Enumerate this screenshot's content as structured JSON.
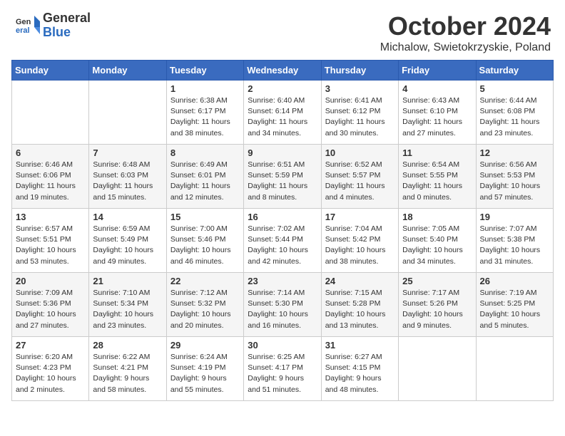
{
  "header": {
    "logo_general": "General",
    "logo_blue": "Blue",
    "month": "October 2024",
    "location": "Michalow, Swietokrzyskie, Poland"
  },
  "days_of_week": [
    "Sunday",
    "Monday",
    "Tuesday",
    "Wednesday",
    "Thursday",
    "Friday",
    "Saturday"
  ],
  "weeks": [
    [
      {
        "day": "",
        "info": ""
      },
      {
        "day": "",
        "info": ""
      },
      {
        "day": "1",
        "info": "Sunrise: 6:38 AM\nSunset: 6:17 PM\nDaylight: 11 hours and 38 minutes."
      },
      {
        "day": "2",
        "info": "Sunrise: 6:40 AM\nSunset: 6:14 PM\nDaylight: 11 hours and 34 minutes."
      },
      {
        "day": "3",
        "info": "Sunrise: 6:41 AM\nSunset: 6:12 PM\nDaylight: 11 hours and 30 minutes."
      },
      {
        "day": "4",
        "info": "Sunrise: 6:43 AM\nSunset: 6:10 PM\nDaylight: 11 hours and 27 minutes."
      },
      {
        "day": "5",
        "info": "Sunrise: 6:44 AM\nSunset: 6:08 PM\nDaylight: 11 hours and 23 minutes."
      }
    ],
    [
      {
        "day": "6",
        "info": "Sunrise: 6:46 AM\nSunset: 6:06 PM\nDaylight: 11 hours and 19 minutes."
      },
      {
        "day": "7",
        "info": "Sunrise: 6:48 AM\nSunset: 6:03 PM\nDaylight: 11 hours and 15 minutes."
      },
      {
        "day": "8",
        "info": "Sunrise: 6:49 AM\nSunset: 6:01 PM\nDaylight: 11 hours and 12 minutes."
      },
      {
        "day": "9",
        "info": "Sunrise: 6:51 AM\nSunset: 5:59 PM\nDaylight: 11 hours and 8 minutes."
      },
      {
        "day": "10",
        "info": "Sunrise: 6:52 AM\nSunset: 5:57 PM\nDaylight: 11 hours and 4 minutes."
      },
      {
        "day": "11",
        "info": "Sunrise: 6:54 AM\nSunset: 5:55 PM\nDaylight: 11 hours and 0 minutes."
      },
      {
        "day": "12",
        "info": "Sunrise: 6:56 AM\nSunset: 5:53 PM\nDaylight: 10 hours and 57 minutes."
      }
    ],
    [
      {
        "day": "13",
        "info": "Sunrise: 6:57 AM\nSunset: 5:51 PM\nDaylight: 10 hours and 53 minutes."
      },
      {
        "day": "14",
        "info": "Sunrise: 6:59 AM\nSunset: 5:49 PM\nDaylight: 10 hours and 49 minutes."
      },
      {
        "day": "15",
        "info": "Sunrise: 7:00 AM\nSunset: 5:46 PM\nDaylight: 10 hours and 46 minutes."
      },
      {
        "day": "16",
        "info": "Sunrise: 7:02 AM\nSunset: 5:44 PM\nDaylight: 10 hours and 42 minutes."
      },
      {
        "day": "17",
        "info": "Sunrise: 7:04 AM\nSunset: 5:42 PM\nDaylight: 10 hours and 38 minutes."
      },
      {
        "day": "18",
        "info": "Sunrise: 7:05 AM\nSunset: 5:40 PM\nDaylight: 10 hours and 34 minutes."
      },
      {
        "day": "19",
        "info": "Sunrise: 7:07 AM\nSunset: 5:38 PM\nDaylight: 10 hours and 31 minutes."
      }
    ],
    [
      {
        "day": "20",
        "info": "Sunrise: 7:09 AM\nSunset: 5:36 PM\nDaylight: 10 hours and 27 minutes."
      },
      {
        "day": "21",
        "info": "Sunrise: 7:10 AM\nSunset: 5:34 PM\nDaylight: 10 hours and 23 minutes."
      },
      {
        "day": "22",
        "info": "Sunrise: 7:12 AM\nSunset: 5:32 PM\nDaylight: 10 hours and 20 minutes."
      },
      {
        "day": "23",
        "info": "Sunrise: 7:14 AM\nSunset: 5:30 PM\nDaylight: 10 hours and 16 minutes."
      },
      {
        "day": "24",
        "info": "Sunrise: 7:15 AM\nSunset: 5:28 PM\nDaylight: 10 hours and 13 minutes."
      },
      {
        "day": "25",
        "info": "Sunrise: 7:17 AM\nSunset: 5:26 PM\nDaylight: 10 hours and 9 minutes."
      },
      {
        "day": "26",
        "info": "Sunrise: 7:19 AM\nSunset: 5:25 PM\nDaylight: 10 hours and 5 minutes."
      }
    ],
    [
      {
        "day": "27",
        "info": "Sunrise: 6:20 AM\nSunset: 4:23 PM\nDaylight: 10 hours and 2 minutes."
      },
      {
        "day": "28",
        "info": "Sunrise: 6:22 AM\nSunset: 4:21 PM\nDaylight: 9 hours and 58 minutes."
      },
      {
        "day": "29",
        "info": "Sunrise: 6:24 AM\nSunset: 4:19 PM\nDaylight: 9 hours and 55 minutes."
      },
      {
        "day": "30",
        "info": "Sunrise: 6:25 AM\nSunset: 4:17 PM\nDaylight: 9 hours and 51 minutes."
      },
      {
        "day": "31",
        "info": "Sunrise: 6:27 AM\nSunset: 4:15 PM\nDaylight: 9 hours and 48 minutes."
      },
      {
        "day": "",
        "info": ""
      },
      {
        "day": "",
        "info": ""
      }
    ]
  ]
}
